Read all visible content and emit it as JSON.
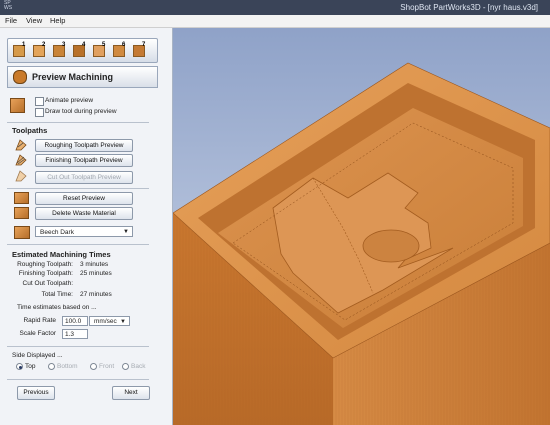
{
  "window": {
    "app_icon_text": "SP\nWS",
    "title": "ShopBot PartWorks3D - [nyr haus.v3d]"
  },
  "menu": {
    "file": "File",
    "view": "View",
    "help": "Help"
  },
  "toolbar": {
    "tool_numbers": [
      "1",
      "2",
      "3",
      "4",
      "5",
      "6",
      "7"
    ]
  },
  "panel": {
    "title": "Preview Machining",
    "animate_preview": "Animate preview",
    "draw_tool": "Draw tool during preview",
    "toolpaths_header": "Toolpaths",
    "roughing_btn": "Roughing Toolpath Preview",
    "finishing_btn": "Finishing Toolpath Preview",
    "cutout_btn": "Cut Out Toolpath Preview",
    "reset_btn": "Reset Preview",
    "delete_waste_btn": "Delete Waste Material",
    "material_select": "Beech Dark",
    "times_header": "Estimated Machining Times",
    "roughing_label": "Roughing Toolpath:",
    "roughing_value": "3 minutes",
    "finishing_label": "Finishing Toolpath:",
    "finishing_value": "25 minutes",
    "cutout_label": "Cut Out Toolpath:",
    "cutout_value": "",
    "total_label": "Total Time:",
    "total_value": "27 minutes",
    "estimates_based": "Time estimates based on ...",
    "rapid_label": "Rapid Rate",
    "rapid_value": "100.0",
    "rapid_unit": "mm/sec",
    "scale_label": "Scale Factor",
    "scale_value": "1.3",
    "side_header": "Side Displayed ...",
    "side_top": "Top",
    "side_bottom": "Bottom",
    "side_front": "Front",
    "side_back": "Back",
    "previous_btn": "Previous",
    "next_btn": "Next"
  },
  "colors": {
    "wood_light": "#e0954d",
    "wood_mid": "#cf7f36",
    "wood_dark": "#b8692a",
    "background_top": "#8fa2c8",
    "background_bottom": "#d3dcec"
  }
}
